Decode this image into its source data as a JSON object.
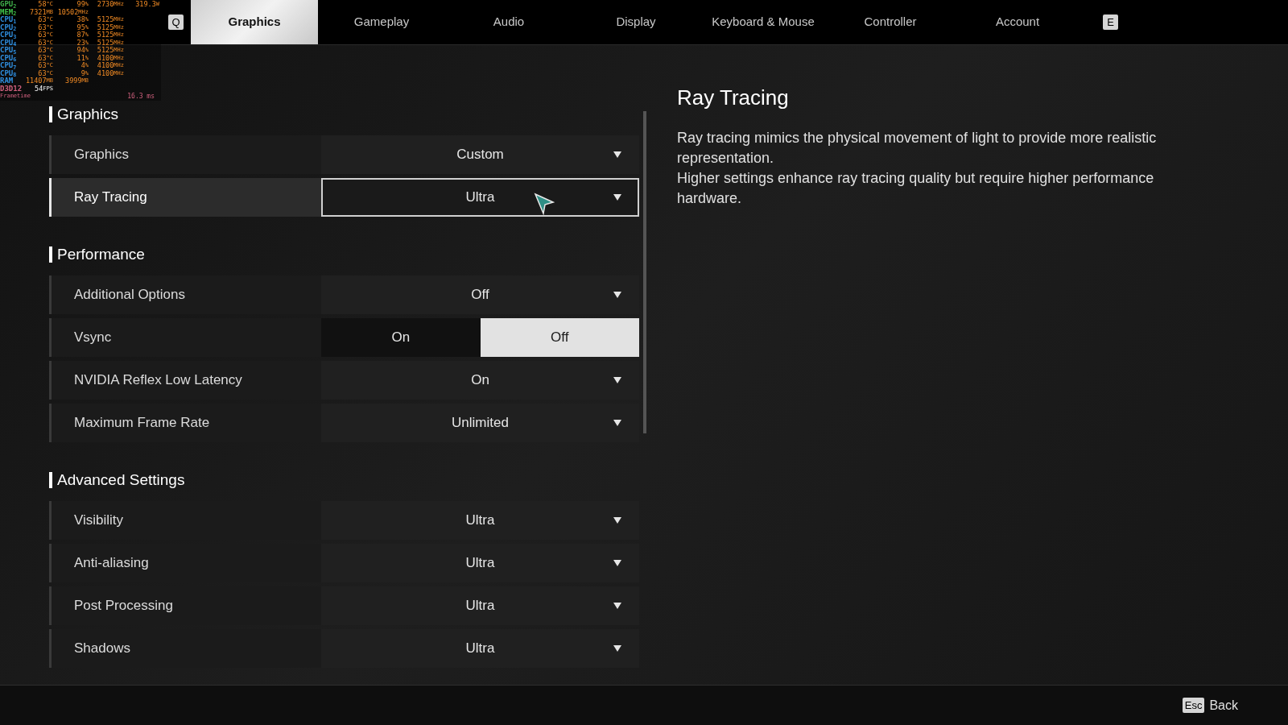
{
  "osd": {
    "rows": [
      {
        "label": "GPU$_{2}$",
        "color": "#3fae4a",
        "values": [
          {
            "value": "58",
            "unit": "°C"
          },
          {
            "value": "99",
            "unit": "%"
          },
          {
            "value": "2730",
            "unit": "MHz"
          },
          {
            "value": "319.3",
            "unit": "W"
          }
        ]
      },
      {
        "label": "MEM$_{2}$",
        "color": "#3fc04a",
        "values": [
          {
            "value": "7321",
            "unit": "MB"
          },
          {
            "value": "10502",
            "unit": "MHz"
          }
        ]
      },
      {
        "label": "CPU$_{1}$",
        "color": "#2f8fe0",
        "values": [
          {
            "value": "63",
            "unit": "°C"
          },
          {
            "value": "38",
            "unit": "%"
          },
          {
            "value": "5125",
            "unit": "MHz"
          }
        ]
      },
      {
        "label": "CPU$_{2}$",
        "color": "#2f8fe0",
        "values": [
          {
            "value": "63",
            "unit": "°C"
          },
          {
            "value": "95",
            "unit": "%"
          },
          {
            "value": "5125",
            "unit": "MHz"
          }
        ]
      },
      {
        "label": "CPU$_{3}$",
        "color": "#2f8fe0",
        "values": [
          {
            "value": "63",
            "unit": "°C"
          },
          {
            "value": "87",
            "unit": "%"
          },
          {
            "value": "5125",
            "unit": "MHz"
          }
        ]
      },
      {
        "label": "CPU$_{4}$",
        "color": "#2f8fe0",
        "values": [
          {
            "value": "63",
            "unit": "°C"
          },
          {
            "value": "23",
            "unit": "%"
          },
          {
            "value": "5125",
            "unit": "MHz"
          }
        ]
      },
      {
        "label": "CPU$_{5}$",
        "color": "#2f8fe0",
        "values": [
          {
            "value": "63",
            "unit": "°C"
          },
          {
            "value": "94",
            "unit": "%"
          },
          {
            "value": "5125",
            "unit": "MHz"
          }
        ]
      },
      {
        "label": "CPU$_{6}$",
        "color": "#2f8fe0",
        "values": [
          {
            "value": "63",
            "unit": "°C"
          },
          {
            "value": "11",
            "unit": "%"
          },
          {
            "value": "4100",
            "unit": "MHz"
          }
        ]
      },
      {
        "label": "CPU$_{7}$",
        "color": "#2f8fe0",
        "values": [
          {
            "value": "63",
            "unit": "°C"
          },
          {
            "value": "4",
            "unit": "%"
          },
          {
            "value": "4100",
            "unit": "MHz"
          }
        ]
      },
      {
        "label": "CPU$_{8}$",
        "color": "#2f8fe0",
        "values": [
          {
            "value": "63",
            "unit": "°C"
          },
          {
            "value": "9",
            "unit": "%"
          },
          {
            "value": "4100",
            "unit": "MHz"
          }
        ]
      },
      {
        "label": "RAM",
        "color": "#2f8fe0",
        "values": [
          {
            "value": "11407",
            "unit": "MB"
          },
          {
            "value": "3999",
            "unit": "MB"
          }
        ]
      },
      {
        "label": "D3D12",
        "color": "#d0607e",
        "values": [
          {
            "value": "54",
            "unit": "FPS"
          }
        ]
      }
    ],
    "frametime_label": "Frametime",
    "frametime_reading": "16.3 ms"
  },
  "tabs": {
    "prev_key": "Q",
    "next_key": "E",
    "items": [
      {
        "label": "Graphics",
        "selected": true
      },
      {
        "label": "Gameplay",
        "selected": false
      },
      {
        "label": "Audio",
        "selected": false
      },
      {
        "label": "Display",
        "selected": false
      },
      {
        "label": "Keyboard & Mouse",
        "selected": false
      },
      {
        "label": "Controller",
        "selected": false
      },
      {
        "label": "Account",
        "selected": false
      }
    ]
  },
  "sections": [
    {
      "title": "Graphics",
      "rows": [
        {
          "label": "Graphics",
          "kind": "dropdown",
          "value": "Custom",
          "selected": false
        },
        {
          "label": "Ray Tracing",
          "kind": "dropdown",
          "value": "Ultra",
          "selected": true
        }
      ]
    },
    {
      "title": "Performance",
      "rows": [
        {
          "label": "Additional Options",
          "kind": "dropdown",
          "value": "Off",
          "selected": false
        },
        {
          "label": "Vsync",
          "kind": "toggle",
          "selected": false,
          "options": [
            {
              "label": "On",
              "selected": false
            },
            {
              "label": "Off",
              "selected": true
            }
          ]
        },
        {
          "label": "NVIDIA Reflex Low Latency",
          "kind": "dropdown",
          "value": "On",
          "selected": false
        },
        {
          "label": "Maximum Frame Rate",
          "kind": "dropdown",
          "value": "Unlimited",
          "selected": false
        }
      ]
    },
    {
      "title": "Advanced Settings",
      "rows": [
        {
          "label": "Visibility",
          "kind": "dropdown",
          "value": "Ultra",
          "selected": false
        },
        {
          "label": "Anti-aliasing",
          "kind": "dropdown",
          "value": "Ultra",
          "selected": false
        },
        {
          "label": "Post Processing",
          "kind": "dropdown",
          "value": "Ultra",
          "selected": false
        },
        {
          "label": "Shadows",
          "kind": "dropdown",
          "value": "Ultra",
          "selected": false
        }
      ]
    }
  ],
  "description": {
    "title": "Ray Tracing",
    "paragraphs": [
      "Ray tracing mimics the physical movement of light to provide more realistic representation.",
      "Higher settings enhance ray tracing quality but require higher performance hardware."
    ]
  },
  "footer": {
    "key": "Esc",
    "label": "Back"
  }
}
